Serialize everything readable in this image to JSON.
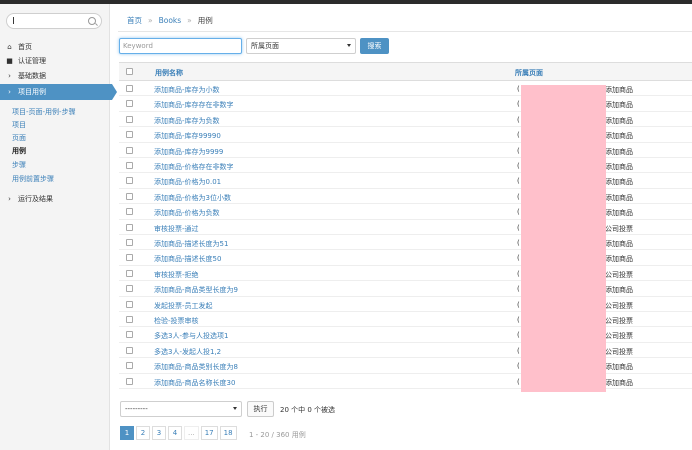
{
  "sidebar": {
    "search_caret": "I",
    "nav": [
      {
        "label": "首页",
        "icon": "home-icon"
      },
      {
        "label": "认证管理",
        "icon": "lock-icon"
      },
      {
        "label": "基础数据",
        "icon": "chevron-right-icon"
      },
      {
        "label": "项目用例",
        "icon": "chevron-right-icon"
      }
    ],
    "sub_items": [
      "项目-页面-用例-步骤",
      "项目",
      "页面",
      "用例",
      "步骤",
      "用例前置步骤"
    ],
    "current_sub_index": 3,
    "footer_nav": {
      "label": "运行及结果",
      "icon": "chevron-right-icon"
    }
  },
  "breadcrumb": {
    "home": "首页",
    "app": "Books",
    "current": "用例",
    "sep": "»"
  },
  "filters": {
    "keyword_placeholder": "Keyword",
    "page_select": "所属页面",
    "search_label": "搜索"
  },
  "table": {
    "headers": {
      "name": "用例名称",
      "page": "所属页面"
    },
    "rows": [
      {
        "name": "添加商品-库存为小数",
        "page_left": "(",
        "page_right": "添加商品"
      },
      {
        "name": "添加商品-库存存在非数字",
        "page_left": "(",
        "page_right": "添加商品"
      },
      {
        "name": "添加商品-库存为负数",
        "page_left": "(",
        "page_right": "添加商品"
      },
      {
        "name": "添加商品-库存99990",
        "page_left": "(",
        "page_right": "添加商品"
      },
      {
        "name": "添加商品-库存为9999",
        "page_left": "(",
        "page_right": "添加商品"
      },
      {
        "name": "添加商品-价格存在非数字",
        "page_left": "(",
        "page_right": "添加商品"
      },
      {
        "name": "添加商品-价格为0.01",
        "page_left": "(",
        "page_right": "添加商品"
      },
      {
        "name": "添加商品-价格为3位小数",
        "page_left": "(",
        "page_right": "添加商品"
      },
      {
        "name": "添加商品-价格为负数",
        "page_left": "(",
        "page_right": "添加商品"
      },
      {
        "name": "审核投票-通过",
        "page_left": "(",
        "page_right": "公司投票"
      },
      {
        "name": "添加商品-描述长度为51",
        "page_left": "(",
        "page_right": "添加商品"
      },
      {
        "name": "添加商品-描述长度50",
        "page_left": "(",
        "page_right": "添加商品"
      },
      {
        "name": "审核投票-拒绝",
        "page_left": "(",
        "page_right": "公司投票"
      },
      {
        "name": "添加商品-商品类型长度为9",
        "page_left": "(",
        "page_right": "添加商品"
      },
      {
        "name": "发起投票-员工发起",
        "page_left": "(",
        "page_right": "公司投票"
      },
      {
        "name": "检验-投票审核",
        "page_left": "(",
        "page_right": "公司投票"
      },
      {
        "name": "多选3人-参与人投选项1",
        "page_left": "(",
        "page_right": "公司投票"
      },
      {
        "name": "多选3人-发起人投1,2",
        "page_left": "(",
        "page_right": "公司投票"
      },
      {
        "name": "添加商品-商品类别长度为8",
        "page_left": "(",
        "page_right": "添加商品"
      },
      {
        "name": "添加商品-商品名称长度30",
        "page_left": "(",
        "page_right": "添加商品"
      }
    ]
  },
  "footer": {
    "action_select": "---------",
    "exec_label": "执行",
    "selection_text": "20 个中 0 个被选",
    "pages": [
      "1",
      "2",
      "3",
      "4",
      "...",
      "17",
      "18"
    ],
    "current_page": "1",
    "total_text": "1 - 20 / 360 用例"
  },
  "colors": {
    "accent": "#4e92c4",
    "link": "#3a7fb8",
    "redaction": "#ffc0cb"
  }
}
